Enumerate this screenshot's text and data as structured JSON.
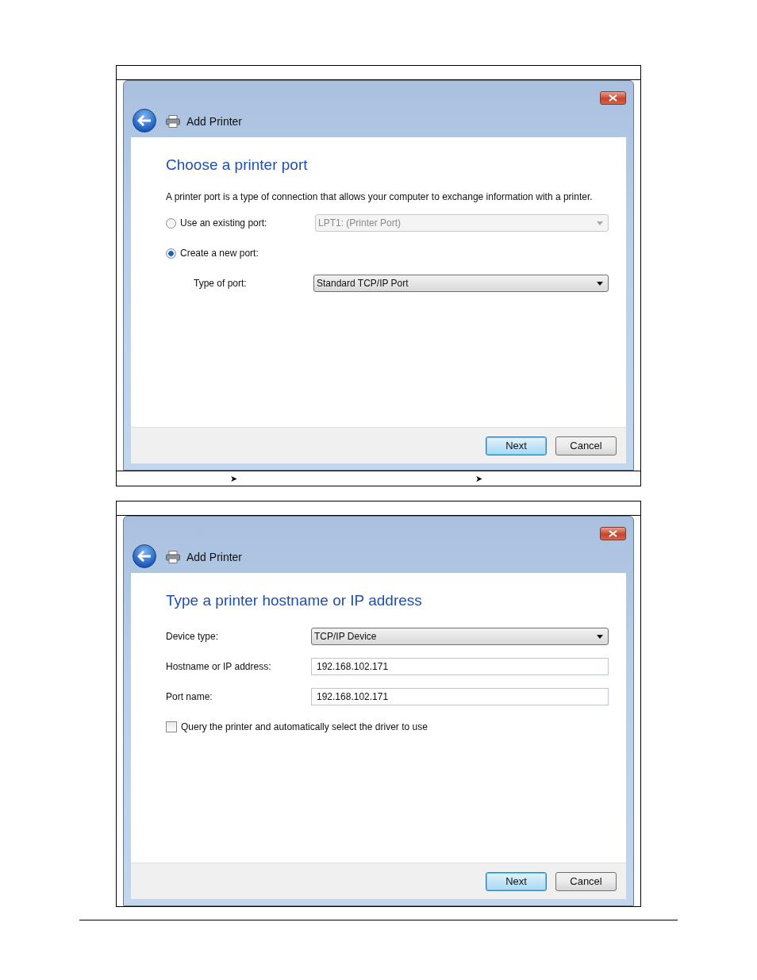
{
  "figures": [
    {
      "dialog": {
        "title": "Add Printer",
        "heading": "Choose a printer port",
        "description": "A printer port is a type of connection that allows your computer to exchange information with a printer.",
        "rows": [
          {
            "kind": "radio",
            "label": "Use an existing port:",
            "selected": false,
            "value": "LPT1: (Printer Port)",
            "disabled": true
          },
          {
            "kind": "radio",
            "label": "Create a new port:",
            "selected": true,
            "children": [
              {
                "kind": "select",
                "label": "Type of port:",
                "value": "Standard TCP/IP Port",
                "disabled": false
              }
            ]
          }
        ],
        "buttons": [
          {
            "label": "Next",
            "default": true
          },
          {
            "label": "Cancel",
            "default": false
          }
        ]
      },
      "arrows": [
        "➤",
        "➤"
      ]
    },
    {
      "dialog": {
        "title": "Add Printer",
        "heading": "Type a printer hostname or IP address",
        "rows": [
          {
            "kind": "select",
            "label": "Device type:",
            "value": "TCP/IP Device",
            "disabled": false
          },
          {
            "kind": "text",
            "label": "Hostname or IP address:",
            "value": "192.168.102.171"
          },
          {
            "kind": "text",
            "label": "Port name:",
            "value": "192.168.102.171"
          },
          {
            "kind": "checkbox",
            "label": "Query the printer and automatically select the driver to use",
            "checked": false
          }
        ],
        "buttons": [
          {
            "label": "Next",
            "default": true
          },
          {
            "label": "Cancel",
            "default": false
          }
        ]
      }
    }
  ]
}
